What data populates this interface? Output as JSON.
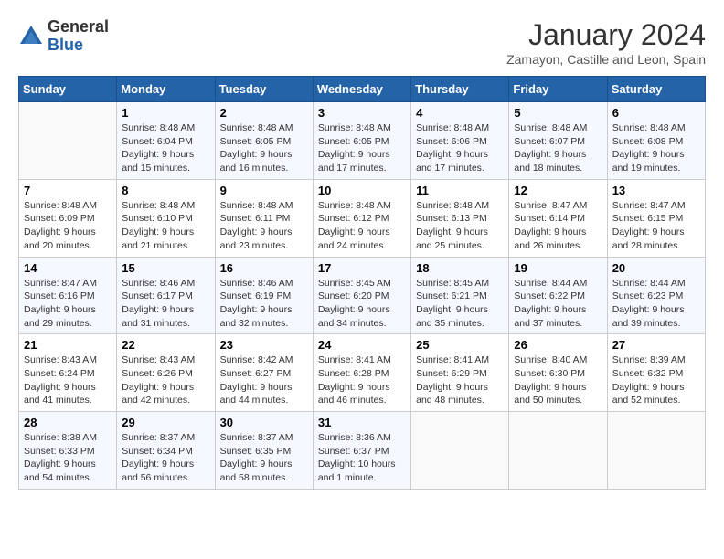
{
  "header": {
    "logo_general": "General",
    "logo_blue": "Blue",
    "month_title": "January 2024",
    "location": "Zamayon, Castille and Leon, Spain"
  },
  "weekdays": [
    "Sunday",
    "Monday",
    "Tuesday",
    "Wednesday",
    "Thursday",
    "Friday",
    "Saturday"
  ],
  "weeks": [
    [
      {
        "day": "",
        "sunrise": "",
        "sunset": "",
        "daylight": ""
      },
      {
        "day": "1",
        "sunrise": "Sunrise: 8:48 AM",
        "sunset": "Sunset: 6:04 PM",
        "daylight": "Daylight: 9 hours and 15 minutes."
      },
      {
        "day": "2",
        "sunrise": "Sunrise: 8:48 AM",
        "sunset": "Sunset: 6:05 PM",
        "daylight": "Daylight: 9 hours and 16 minutes."
      },
      {
        "day": "3",
        "sunrise": "Sunrise: 8:48 AM",
        "sunset": "Sunset: 6:05 PM",
        "daylight": "Daylight: 9 hours and 17 minutes."
      },
      {
        "day": "4",
        "sunrise": "Sunrise: 8:48 AM",
        "sunset": "Sunset: 6:06 PM",
        "daylight": "Daylight: 9 hours and 17 minutes."
      },
      {
        "day": "5",
        "sunrise": "Sunrise: 8:48 AM",
        "sunset": "Sunset: 6:07 PM",
        "daylight": "Daylight: 9 hours and 18 minutes."
      },
      {
        "day": "6",
        "sunrise": "Sunrise: 8:48 AM",
        "sunset": "Sunset: 6:08 PM",
        "daylight": "Daylight: 9 hours and 19 minutes."
      }
    ],
    [
      {
        "day": "7",
        "sunrise": "Sunrise: 8:48 AM",
        "sunset": "Sunset: 6:09 PM",
        "daylight": "Daylight: 9 hours and 20 minutes."
      },
      {
        "day": "8",
        "sunrise": "Sunrise: 8:48 AM",
        "sunset": "Sunset: 6:10 PM",
        "daylight": "Daylight: 9 hours and 21 minutes."
      },
      {
        "day": "9",
        "sunrise": "Sunrise: 8:48 AM",
        "sunset": "Sunset: 6:11 PM",
        "daylight": "Daylight: 9 hours and 23 minutes."
      },
      {
        "day": "10",
        "sunrise": "Sunrise: 8:48 AM",
        "sunset": "Sunset: 6:12 PM",
        "daylight": "Daylight: 9 hours and 24 minutes."
      },
      {
        "day": "11",
        "sunrise": "Sunrise: 8:48 AM",
        "sunset": "Sunset: 6:13 PM",
        "daylight": "Daylight: 9 hours and 25 minutes."
      },
      {
        "day": "12",
        "sunrise": "Sunrise: 8:47 AM",
        "sunset": "Sunset: 6:14 PM",
        "daylight": "Daylight: 9 hours and 26 minutes."
      },
      {
        "day": "13",
        "sunrise": "Sunrise: 8:47 AM",
        "sunset": "Sunset: 6:15 PM",
        "daylight": "Daylight: 9 hours and 28 minutes."
      }
    ],
    [
      {
        "day": "14",
        "sunrise": "Sunrise: 8:47 AM",
        "sunset": "Sunset: 6:16 PM",
        "daylight": "Daylight: 9 hours and 29 minutes."
      },
      {
        "day": "15",
        "sunrise": "Sunrise: 8:46 AM",
        "sunset": "Sunset: 6:17 PM",
        "daylight": "Daylight: 9 hours and 31 minutes."
      },
      {
        "day": "16",
        "sunrise": "Sunrise: 8:46 AM",
        "sunset": "Sunset: 6:19 PM",
        "daylight": "Daylight: 9 hours and 32 minutes."
      },
      {
        "day": "17",
        "sunrise": "Sunrise: 8:45 AM",
        "sunset": "Sunset: 6:20 PM",
        "daylight": "Daylight: 9 hours and 34 minutes."
      },
      {
        "day": "18",
        "sunrise": "Sunrise: 8:45 AM",
        "sunset": "Sunset: 6:21 PM",
        "daylight": "Daylight: 9 hours and 35 minutes."
      },
      {
        "day": "19",
        "sunrise": "Sunrise: 8:44 AM",
        "sunset": "Sunset: 6:22 PM",
        "daylight": "Daylight: 9 hours and 37 minutes."
      },
      {
        "day": "20",
        "sunrise": "Sunrise: 8:44 AM",
        "sunset": "Sunset: 6:23 PM",
        "daylight": "Daylight: 9 hours and 39 minutes."
      }
    ],
    [
      {
        "day": "21",
        "sunrise": "Sunrise: 8:43 AM",
        "sunset": "Sunset: 6:24 PM",
        "daylight": "Daylight: 9 hours and 41 minutes."
      },
      {
        "day": "22",
        "sunrise": "Sunrise: 8:43 AM",
        "sunset": "Sunset: 6:26 PM",
        "daylight": "Daylight: 9 hours and 42 minutes."
      },
      {
        "day": "23",
        "sunrise": "Sunrise: 8:42 AM",
        "sunset": "Sunset: 6:27 PM",
        "daylight": "Daylight: 9 hours and 44 minutes."
      },
      {
        "day": "24",
        "sunrise": "Sunrise: 8:41 AM",
        "sunset": "Sunset: 6:28 PM",
        "daylight": "Daylight: 9 hours and 46 minutes."
      },
      {
        "day": "25",
        "sunrise": "Sunrise: 8:41 AM",
        "sunset": "Sunset: 6:29 PM",
        "daylight": "Daylight: 9 hours and 48 minutes."
      },
      {
        "day": "26",
        "sunrise": "Sunrise: 8:40 AM",
        "sunset": "Sunset: 6:30 PM",
        "daylight": "Daylight: 9 hours and 50 minutes."
      },
      {
        "day": "27",
        "sunrise": "Sunrise: 8:39 AM",
        "sunset": "Sunset: 6:32 PM",
        "daylight": "Daylight: 9 hours and 52 minutes."
      }
    ],
    [
      {
        "day": "28",
        "sunrise": "Sunrise: 8:38 AM",
        "sunset": "Sunset: 6:33 PM",
        "daylight": "Daylight: 9 hours and 54 minutes."
      },
      {
        "day": "29",
        "sunrise": "Sunrise: 8:37 AM",
        "sunset": "Sunset: 6:34 PM",
        "daylight": "Daylight: 9 hours and 56 minutes."
      },
      {
        "day": "30",
        "sunrise": "Sunrise: 8:37 AM",
        "sunset": "Sunset: 6:35 PM",
        "daylight": "Daylight: 9 hours and 58 minutes."
      },
      {
        "day": "31",
        "sunrise": "Sunrise: 8:36 AM",
        "sunset": "Sunset: 6:37 PM",
        "daylight": "Daylight: 10 hours and 1 minute."
      },
      {
        "day": "",
        "sunrise": "",
        "sunset": "",
        "daylight": ""
      },
      {
        "day": "",
        "sunrise": "",
        "sunset": "",
        "daylight": ""
      },
      {
        "day": "",
        "sunrise": "",
        "sunset": "",
        "daylight": ""
      }
    ]
  ]
}
